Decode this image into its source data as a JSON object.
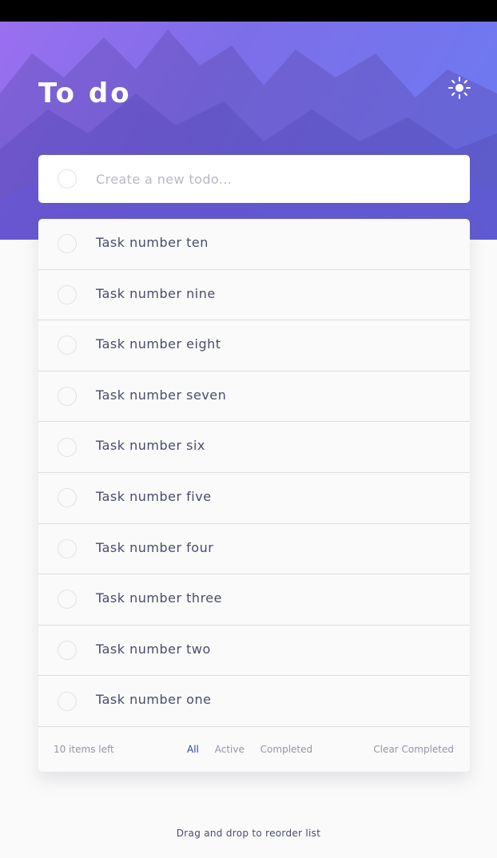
{
  "app": {
    "title": "To do"
  },
  "new_todo": {
    "placeholder": "Create a new todo..."
  },
  "todos": [
    {
      "label": "Task number ten",
      "completed": false
    },
    {
      "label": "Task number nine",
      "completed": false
    },
    {
      "label": "Task number eight",
      "completed": false
    },
    {
      "label": "Task number seven",
      "completed": false
    },
    {
      "label": "Task number six",
      "completed": false
    },
    {
      "label": "Task number five",
      "completed": false
    },
    {
      "label": "Task number four",
      "completed": false
    },
    {
      "label": "Task number three",
      "completed": false
    },
    {
      "label": "Task number two",
      "completed": false
    },
    {
      "label": "Task number one",
      "completed": false
    }
  ],
  "footer": {
    "items_left": "10 items left",
    "filters": [
      "All",
      "Active",
      "Completed"
    ],
    "selected_filter": "All",
    "clear_label": "Clear Completed"
  },
  "hint": "Drag and drop to reorder list",
  "icons": {
    "theme_toggle": "sun-icon"
  },
  "colors": {
    "accent": "#2846a8",
    "text": "#494c6b",
    "muted": "#9495a5"
  }
}
